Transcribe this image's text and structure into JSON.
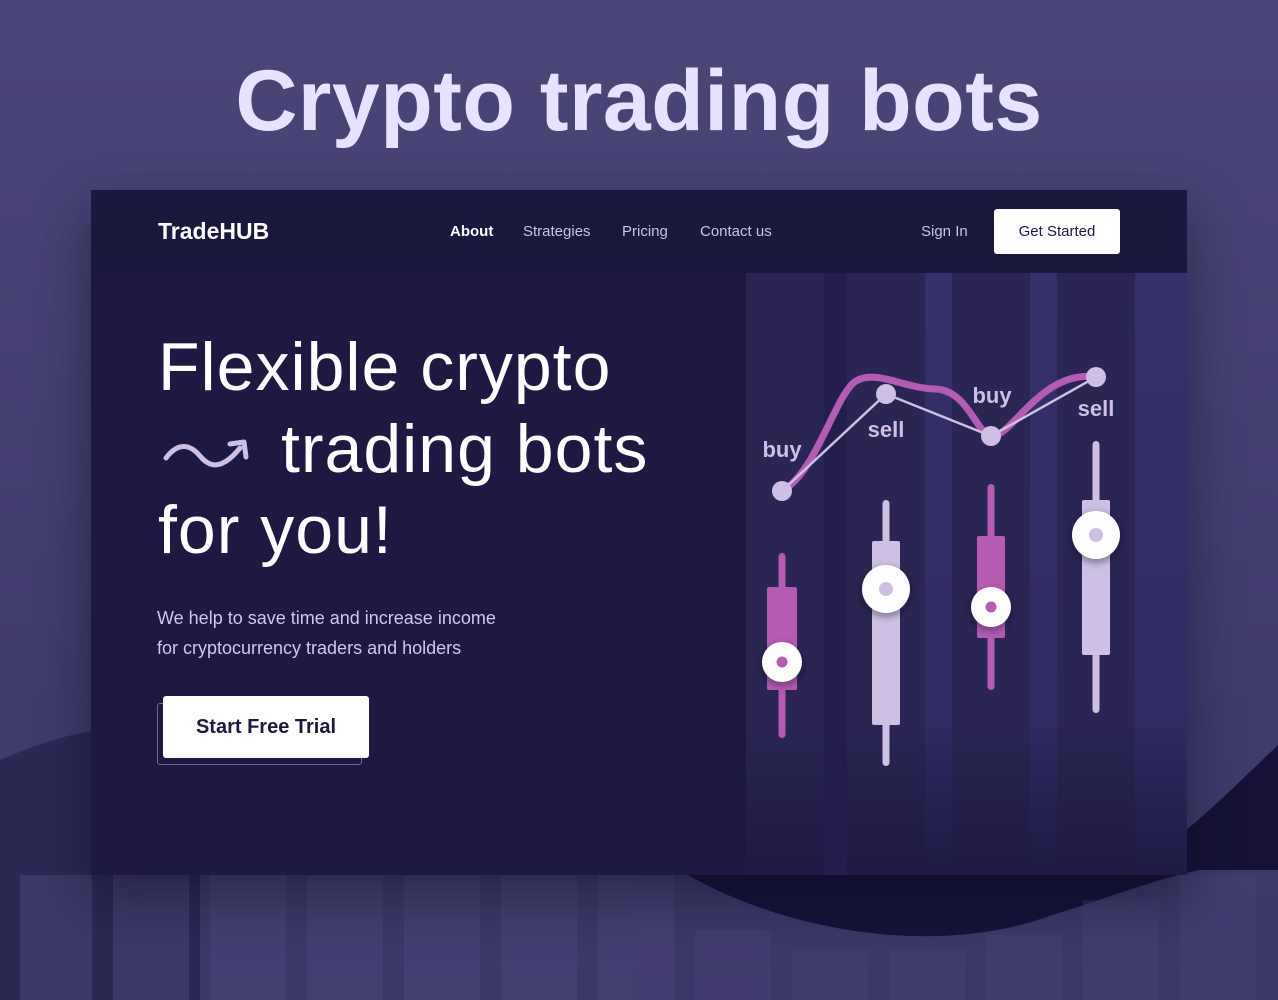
{
  "banner": {
    "title": "Crypto trading bots"
  },
  "header": {
    "logo": "TradeHUB",
    "nav": [
      {
        "label": "About",
        "active": true
      },
      {
        "label": "Strategies",
        "active": false
      },
      {
        "label": "Pricing",
        "active": false
      },
      {
        "label": "Contact us",
        "active": false
      }
    ],
    "sign_in": "Sign In",
    "cta": "Get Started"
  },
  "hero": {
    "headline_line1": "Flexible crypto",
    "headline_line2": "trading bots",
    "headline_line3": "for you!",
    "tagline_line1": "We help to save time and increase income",
    "tagline_line2": "for cryptocurrency traders and holders",
    "cta": "Start Free Trial"
  },
  "illustration": {
    "signals": [
      {
        "label": "buy"
      },
      {
        "label": "sell"
      },
      {
        "label": "buy"
      },
      {
        "label": "sell"
      }
    ],
    "colors": {
      "pink": "#b55bb2",
      "lavender": "#cdc0e3",
      "background": "#1d1942",
      "page": "#44406f"
    }
  }
}
